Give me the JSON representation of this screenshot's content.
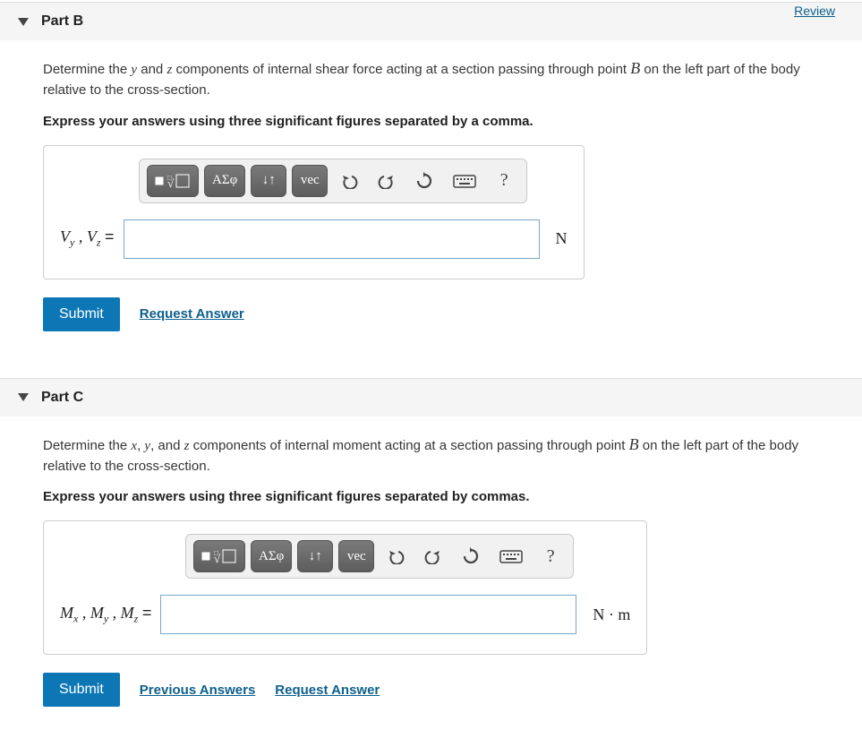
{
  "review_link": "Review",
  "toolbar": {
    "greek": "ΑΣφ",
    "vec": "vec",
    "arrows": "↓↑"
  },
  "partB": {
    "title": "Part B",
    "prompt_pre": "Determine the ",
    "var_y": "y",
    "prompt_and1": " and ",
    "var_z": "z",
    "prompt_mid": " components of internal shear force acting at a section passing through point ",
    "point": "B",
    "prompt_post": " on the left part of the body relative to the cross-section.",
    "instruction": "Express your answers using three significant figures separated by a comma.",
    "lhs_html": "V<sub>y</sub> ,  V<sub>z</sub>  =",
    "unit": "N",
    "submit": "Submit",
    "request_answer": "Request Answer"
  },
  "partC": {
    "title": "Part C",
    "prompt_pre": "Determine the ",
    "var_x": "x",
    "prompt_c1": ", ",
    "var_y": "y",
    "prompt_c2": ", and ",
    "var_z": "z",
    "prompt_mid": " components of internal moment acting at a section passing through point ",
    "point": "B",
    "prompt_post": " on the left part of the body relative to the cross-section.",
    "instruction": "Express your answers using three significant figures separated by commas.",
    "lhs_html": "M<sub>x</sub> ,  M<sub>y</sub> ,  M<sub>z</sub>  =",
    "unit": "N · m",
    "submit": "Submit",
    "previous_answers": "Previous Answers",
    "request_answer": "Request Answer"
  }
}
